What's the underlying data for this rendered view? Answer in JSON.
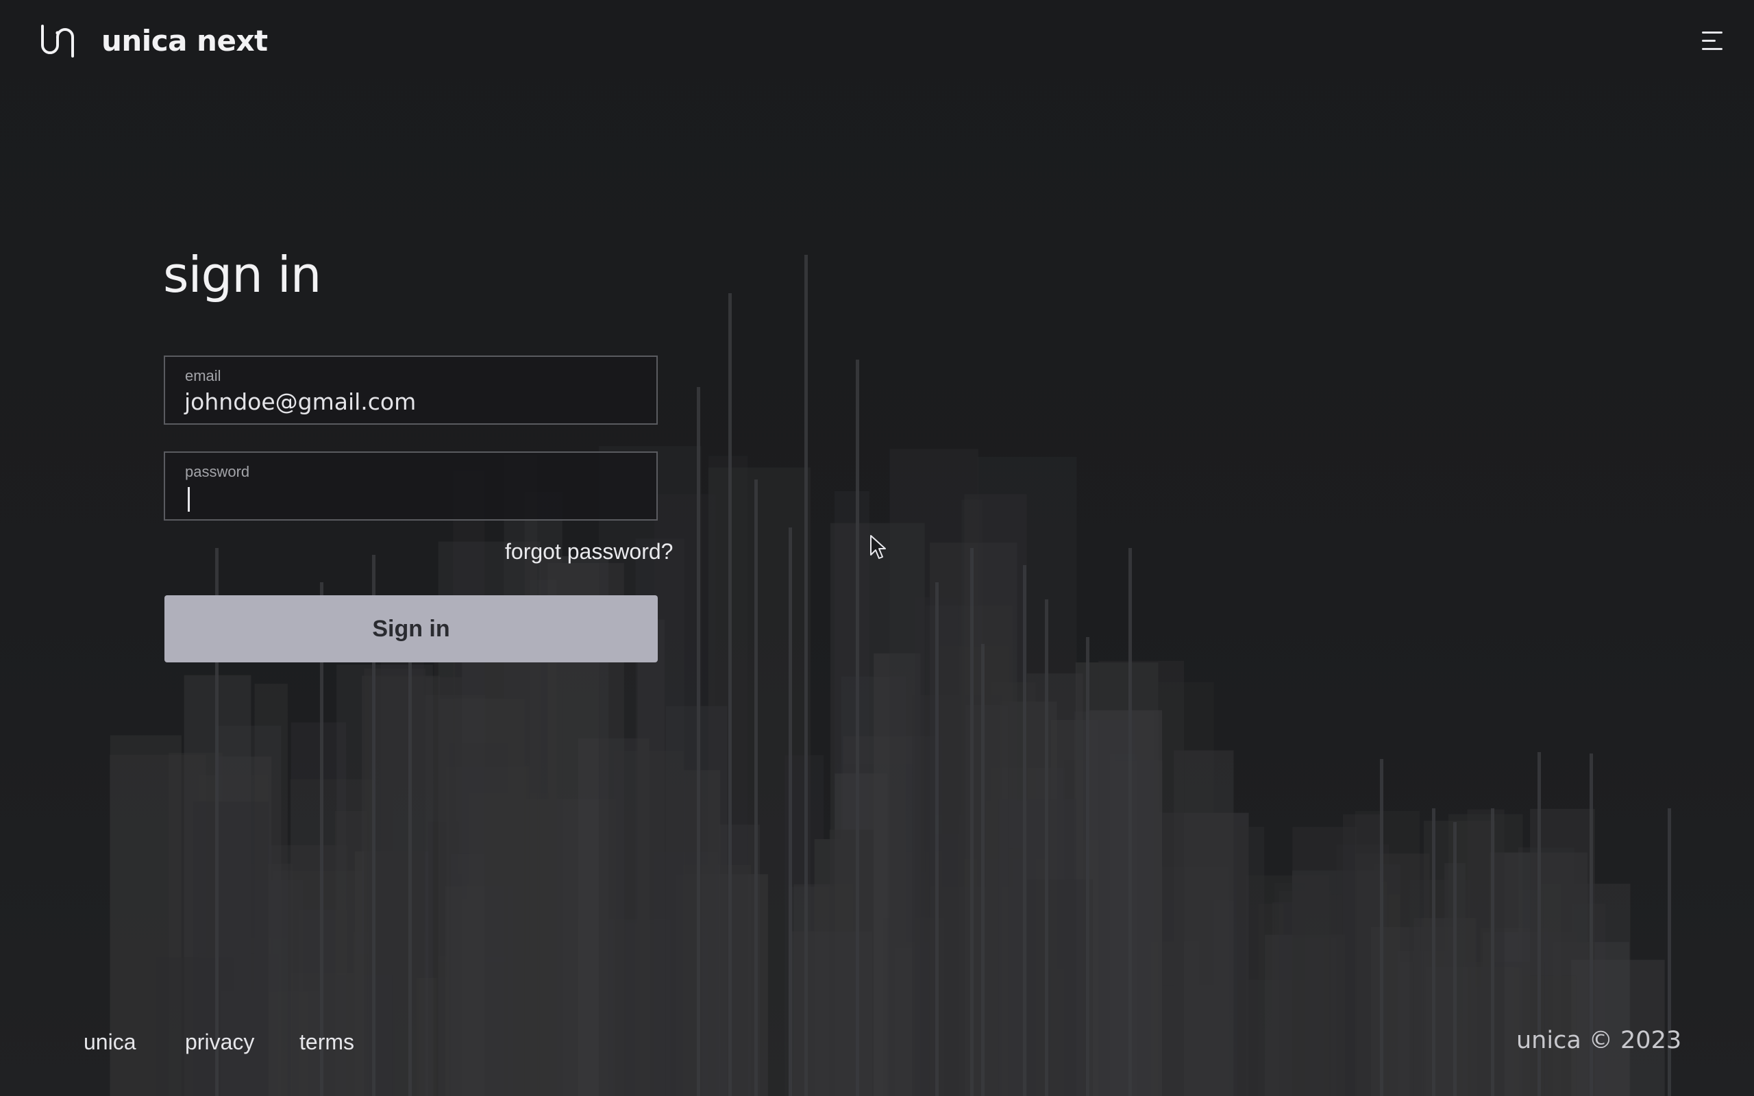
{
  "header": {
    "brand_name": "unica next",
    "logo_icon": "unica-logo-icon",
    "menu_icon": "hamburger-menu-icon"
  },
  "signin": {
    "title": "sign in",
    "email": {
      "label": "email",
      "value": "johndoe@gmail.com"
    },
    "password": {
      "label": "password",
      "value": ""
    },
    "forgot_password": "forgot password?",
    "submit_label": "Sign in"
  },
  "footer": {
    "links": [
      "unica",
      "privacy",
      "terms"
    ],
    "copyright": "unica © 2023"
  },
  "colors": {
    "background": "#1b1c1e",
    "button": "#b0b0bb",
    "button_text": "#2a2b30",
    "field_border": "#5a5b60",
    "text": "#e9e9ec"
  }
}
